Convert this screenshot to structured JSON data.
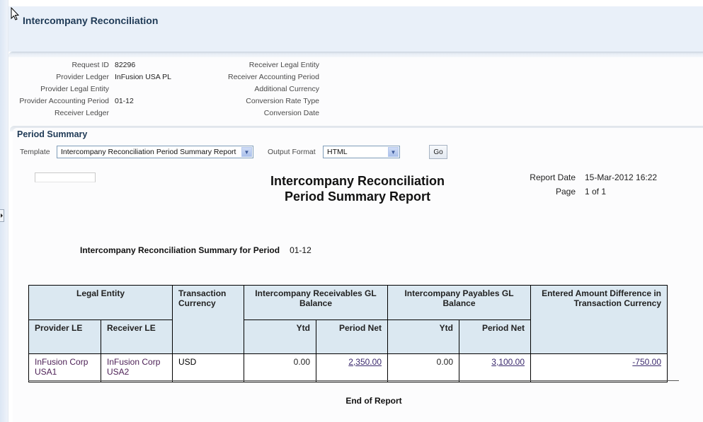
{
  "page": {
    "title": "Intercompany Reconciliation"
  },
  "request_info": {
    "left": [
      {
        "label": "Request ID",
        "value": "82296"
      },
      {
        "label": "Provider Ledger",
        "value": "InFusion USA PL"
      },
      {
        "label": "Provider Legal Entity",
        "value": ""
      },
      {
        "label": "Provider Accounting Period",
        "value": "01-12"
      },
      {
        "label": "Receiver Ledger",
        "value": ""
      }
    ],
    "right": [
      {
        "label": "Receiver Legal Entity",
        "value": ""
      },
      {
        "label": "Receiver Accounting Period",
        "value": ""
      },
      {
        "label": "Additional Currency",
        "value": ""
      },
      {
        "label": "Conversion Rate Type",
        "value": ""
      },
      {
        "label": "Conversion Date",
        "value": ""
      }
    ]
  },
  "period_summary": {
    "section_title": "Period Summary",
    "template_label": "Template",
    "template_value": "Intercompany Reconciliation Period Summary Report",
    "output_format_label": "Output Format",
    "output_format_value": "HTML",
    "go_label": "Go"
  },
  "report": {
    "title_line1": "Intercompany Reconciliation",
    "title_line2": "Period Summary Report",
    "report_date_label": "Report Date",
    "report_date_value": "15-Mar-2012 16:22",
    "page_label": "Page",
    "page_value": "1 of 1",
    "summary_label": "Intercompany Reconciliation Summary for Period",
    "summary_period": "01-12",
    "table": {
      "headers": {
        "legal_entity": "Legal Entity",
        "provider_le": "Provider LE",
        "receiver_le": "Receiver LE",
        "transaction_currency": "Transaction Currency",
        "receivables_group": "Intercompany Receivables GL Balance",
        "payables_group": "Intercompany Payables GL Balance",
        "ytd": "Ytd",
        "period_net": "Period Net",
        "difference": "Entered Amount Difference in Transaction Currency"
      },
      "rows": [
        {
          "provider_le": "InFusion Corp USA1",
          "receiver_le": "InFusion Corp USA2",
          "currency": "USD",
          "receivables_ytd": "0.00",
          "receivables_period_net": "2,350.00",
          "payables_ytd": "0.00",
          "payables_period_net": "3,100.00",
          "difference": "-750.00"
        }
      ]
    },
    "end_text": "End of Report"
  }
}
